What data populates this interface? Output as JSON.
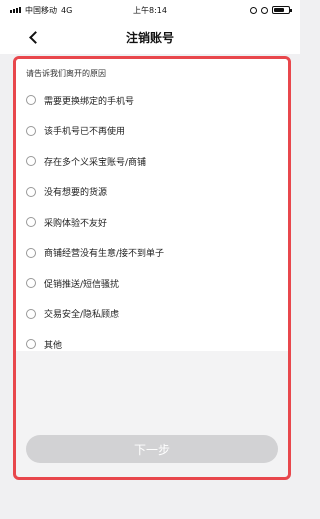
{
  "status_bar": {
    "carrier": "中国移动",
    "network": "4G",
    "time": "上午8:14"
  },
  "nav": {
    "back_icon": "chevron-left-icon",
    "title": "注销账号"
  },
  "form": {
    "prompt": "请告诉我们离开的原因",
    "options": [
      {
        "label": "需要更换绑定的手机号"
      },
      {
        "label": "该手机号已不再使用"
      },
      {
        "label": "存在多个义采宝账号/商铺"
      },
      {
        "label": "没有想要的货源"
      },
      {
        "label": "采购体验不友好"
      },
      {
        "label": "商铺经营没有生意/接不到单子"
      },
      {
        "label": "促销推送/短信骚扰"
      },
      {
        "label": "交易安全/隐私顾虑"
      },
      {
        "label": "其他"
      }
    ],
    "next_label": "下一步"
  },
  "colors": {
    "highlight_border": "#e8474c",
    "button_disabled": "#d2d2d4"
  }
}
